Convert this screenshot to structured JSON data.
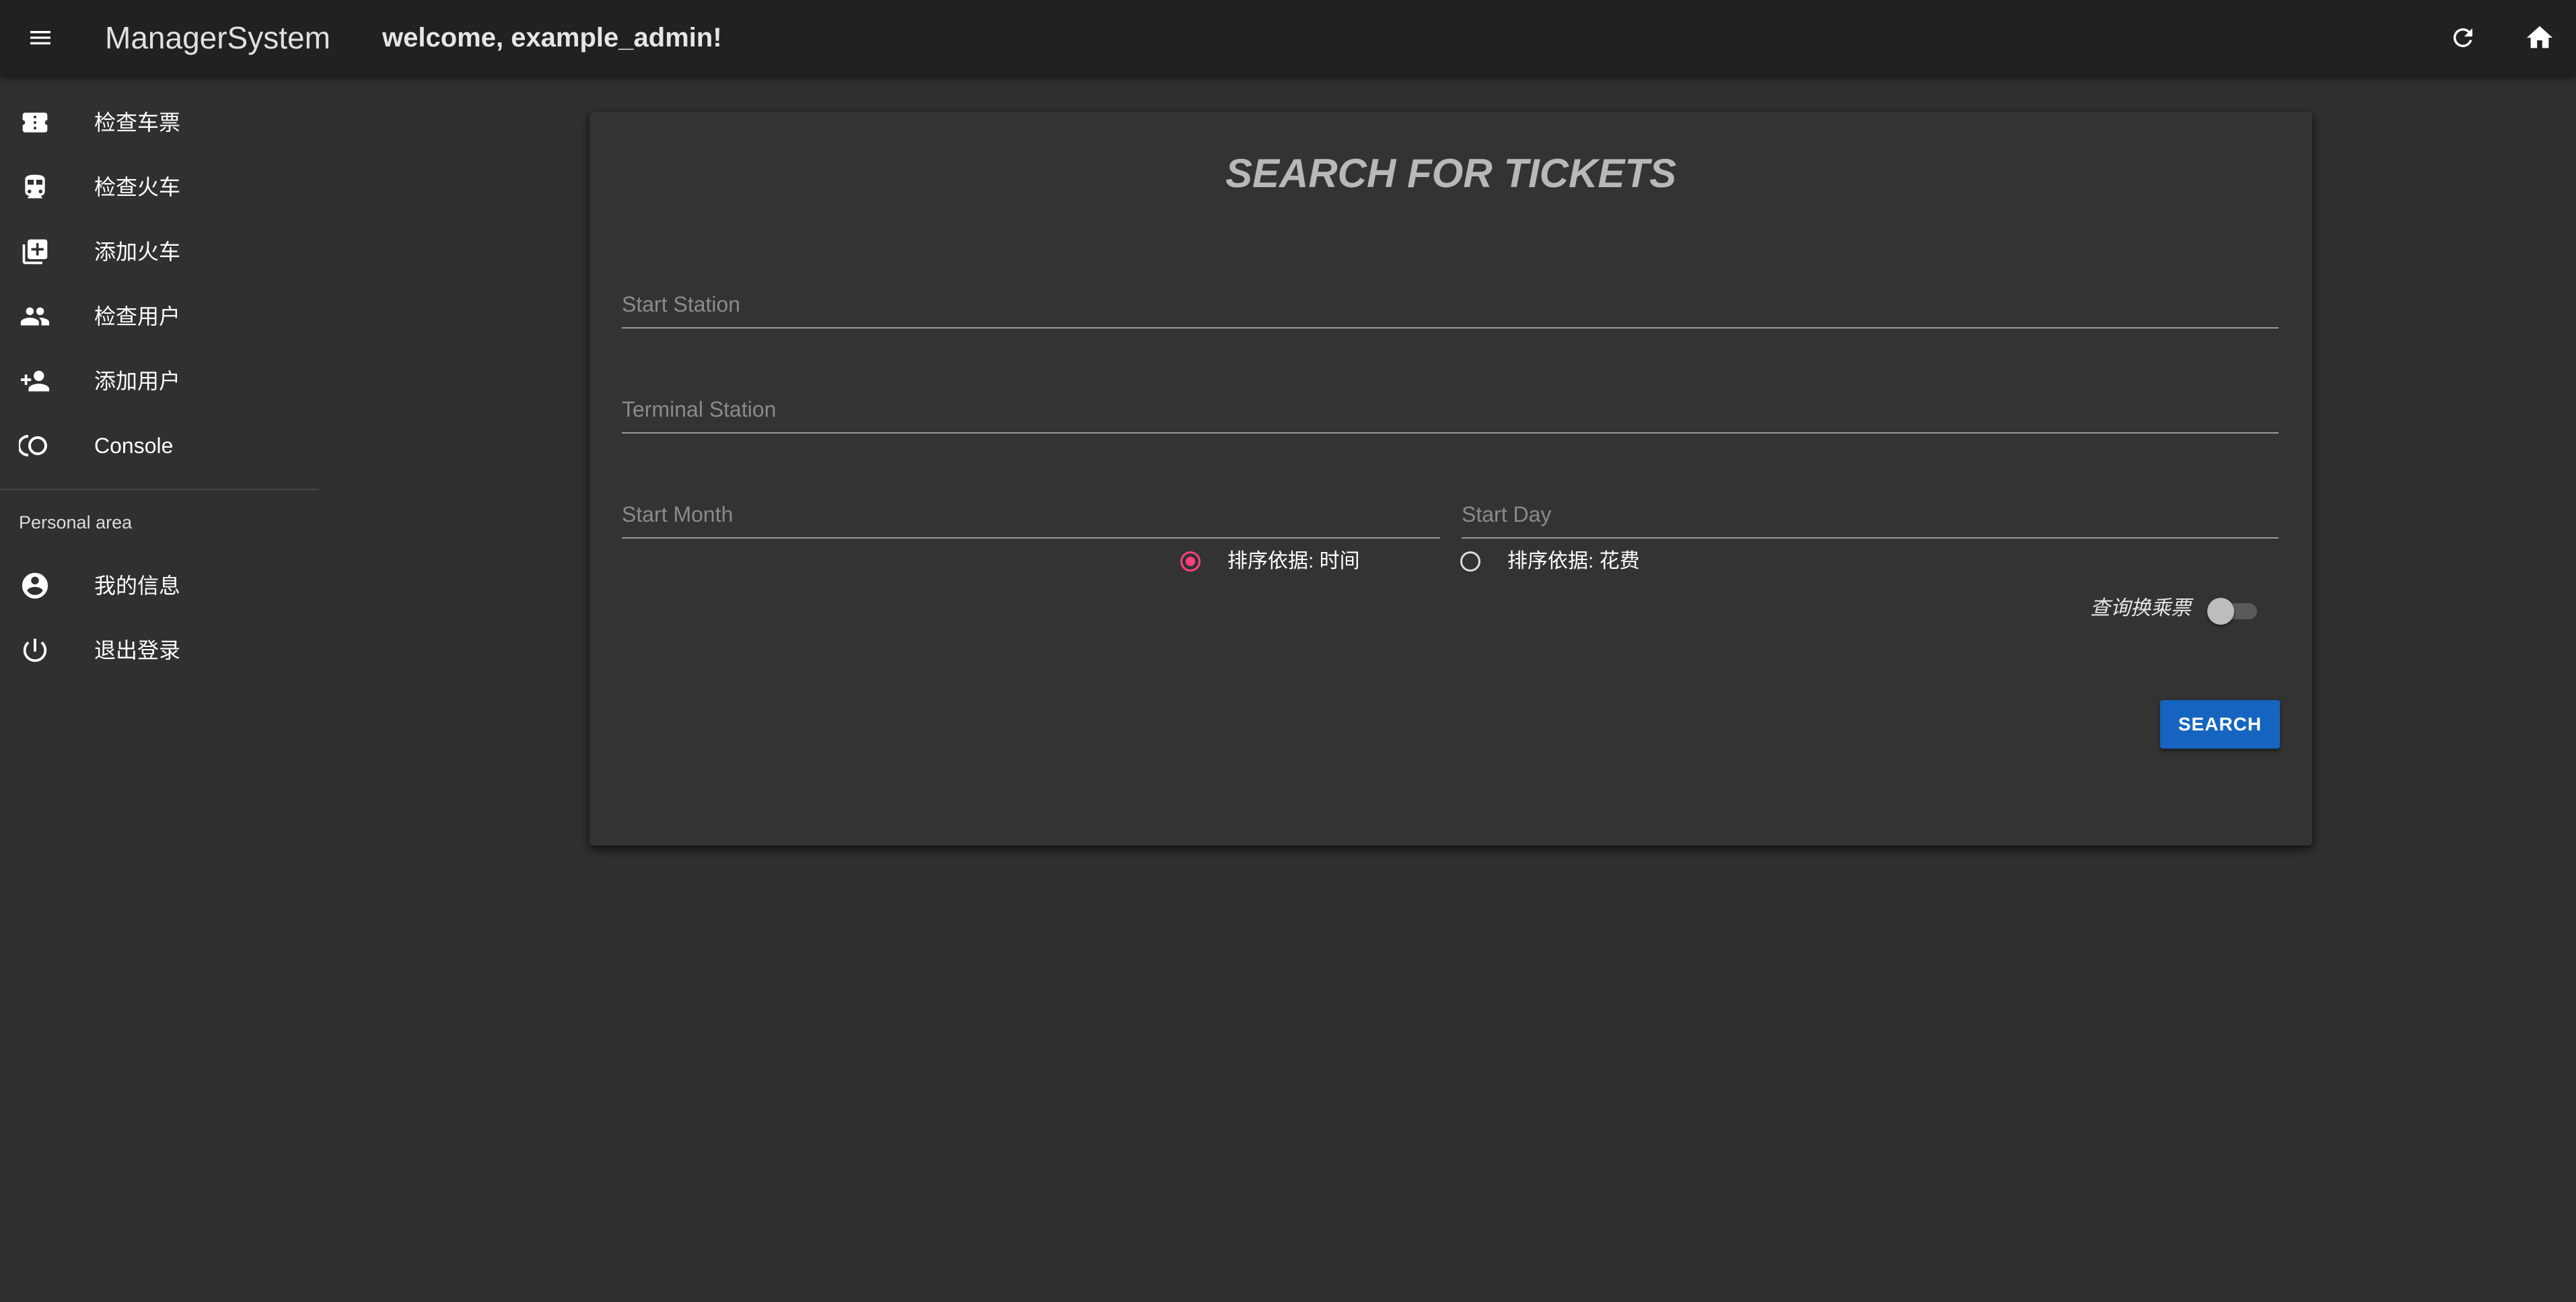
{
  "app": {
    "title": "ManagerSystem",
    "welcome": "welcome, example_admin!"
  },
  "icons": {
    "menu": "menu-icon",
    "refresh": "refresh-icon",
    "home": "home-icon"
  },
  "sidebar": {
    "items": [
      {
        "label": "检查车票",
        "icon": "ticket-icon"
      },
      {
        "label": "检查火车",
        "icon": "train-icon"
      },
      {
        "label": "添加火车",
        "icon": "add-box-icon"
      },
      {
        "label": "检查用户",
        "icon": "people-icon"
      },
      {
        "label": "添加用户",
        "icon": "person-add-icon"
      },
      {
        "label": "Console",
        "icon": "console-icon"
      }
    ],
    "personal_header": "Personal area",
    "personal_items": [
      {
        "label": "我的信息",
        "icon": "account-circle-icon"
      },
      {
        "label": "退出登录",
        "icon": "power-icon"
      }
    ]
  },
  "search": {
    "title": "SEARCH FOR TICKETS",
    "start_station_placeholder": "Start Station",
    "terminal_station_placeholder": "Terminal Station",
    "start_month_placeholder": "Start Month",
    "start_day_placeholder": "Start Day",
    "sort_by_time_label": "排序依据: 时间",
    "sort_by_cost_label": "排序依据: 花费",
    "sort_selected": "time",
    "transfer_label": "查询换乘票",
    "transfer_enabled": false,
    "search_button": "SEARCH"
  },
  "colors": {
    "background": "#303030",
    "appbar": "#212121",
    "card": "#333333",
    "accent_radio": "#ff4081",
    "primary_button": "#1565c0"
  }
}
